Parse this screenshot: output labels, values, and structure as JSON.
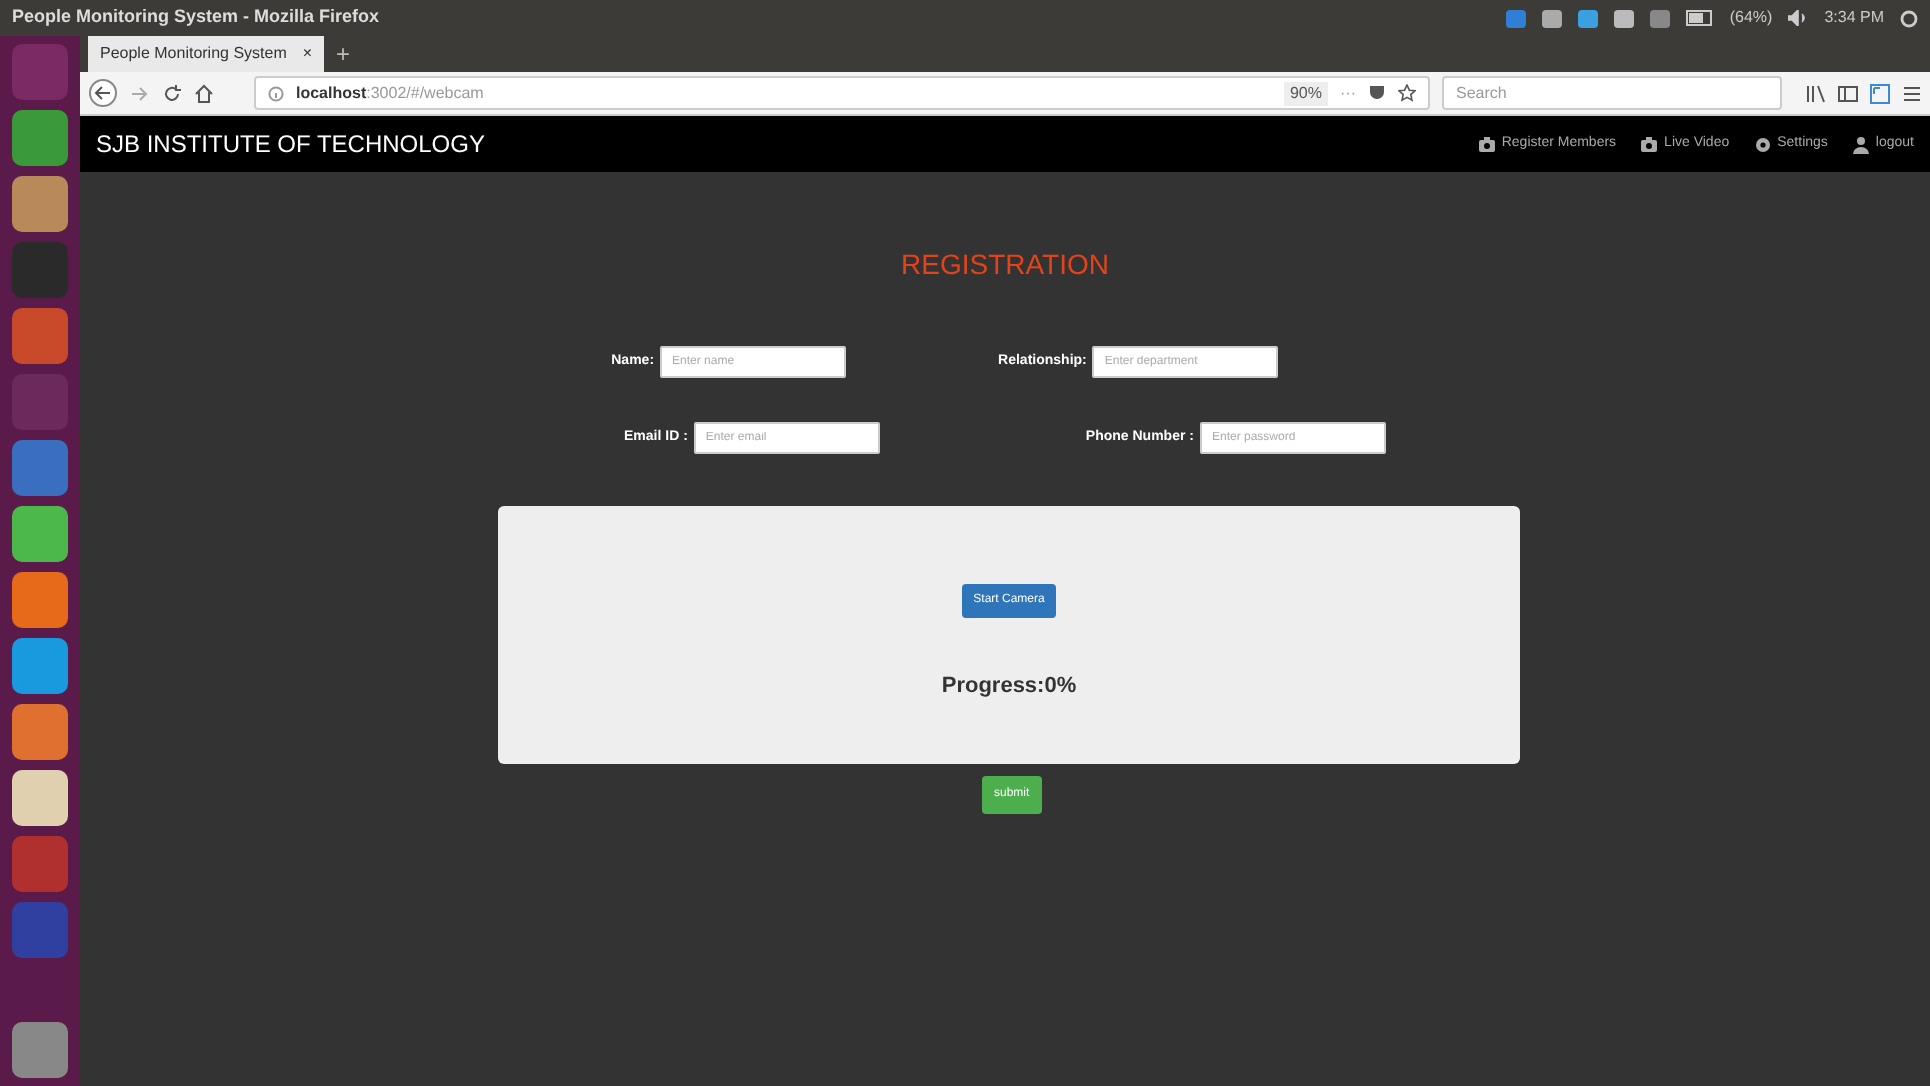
{
  "window": {
    "title": "People Monitoring System - Mozilla Firefox"
  },
  "tray": {
    "battery": "(64%)",
    "time": "3:34 PM"
  },
  "browser": {
    "tab": {
      "title": "People Monitoring System",
      "close": "×"
    },
    "new_tab": "+",
    "url": {
      "host": "localhost",
      "path": ":3002/#/webcam"
    },
    "zoom": "90%",
    "more": "···",
    "search": {
      "placeholder": "Search"
    }
  },
  "app": {
    "brand": "SJB INSTITUTE OF TECHNOLOGY",
    "nav": [
      {
        "kind": "camera",
        "label": "Register Members"
      },
      {
        "kind": "camera",
        "label": "Live Video"
      },
      {
        "kind": "gear",
        "label": "Settings"
      },
      {
        "kind": "user",
        "label": "logout"
      }
    ],
    "heading": "REGISTRATION",
    "form_rows": [
      [
        {
          "label": "Name:",
          "placeholder": "Enter name"
        },
        {
          "label": "Relationship:",
          "placeholder": "Enter department"
        }
      ],
      [
        {
          "label": "Email ID :",
          "placeholder": "Enter email"
        },
        {
          "label": "Phone Number :",
          "placeholder": "Enter password"
        }
      ]
    ],
    "start_button": "Start Camera",
    "progress": "Progress:0%",
    "submit": "submit"
  }
}
